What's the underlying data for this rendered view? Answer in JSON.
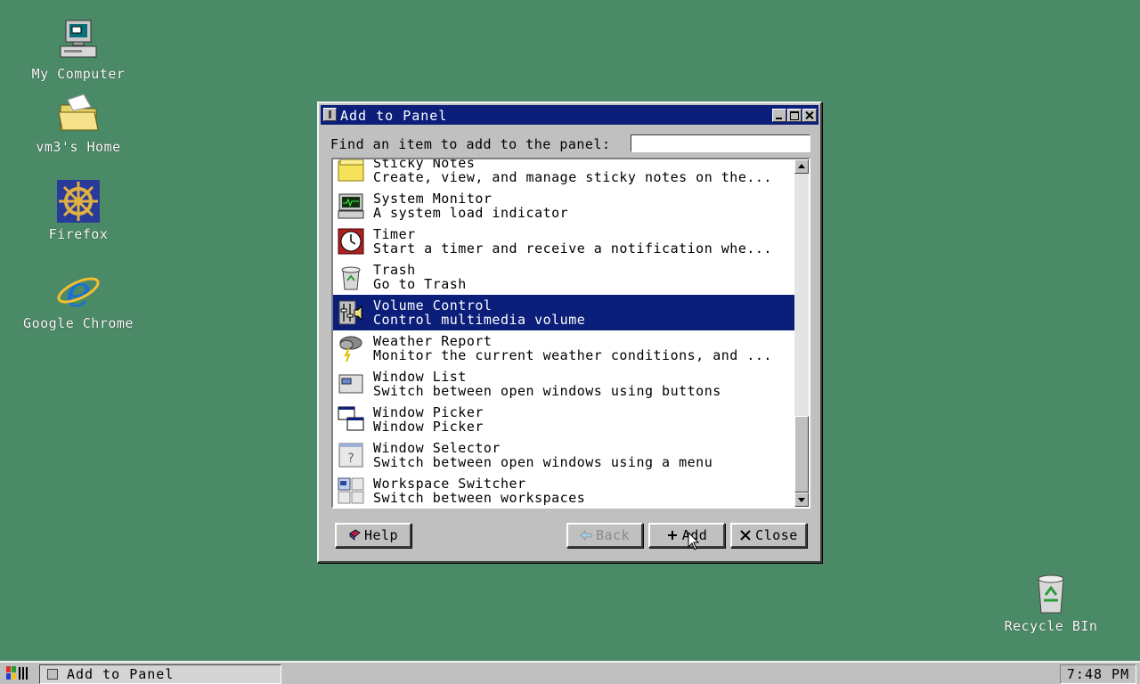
{
  "desktop": {
    "icons": [
      {
        "label": "My Computer",
        "icon": "computer-icon"
      },
      {
        "label": "vm3's Home",
        "icon": "folder-icon"
      },
      {
        "label": "Firefox",
        "icon": "firefox-icon"
      },
      {
        "label": "Google Chrome",
        "icon": "chrome-icon"
      },
      {
        "label": "Recycle BIn",
        "icon": "recycle-bin-icon"
      }
    ]
  },
  "window": {
    "title": "Add to Panel",
    "find_label": "Find an item to add to the panel:",
    "find_value": "",
    "items": [
      {
        "name": "Sticky Notes",
        "desc": "Create, view, and manage sticky notes on the...",
        "icon": "sticky-notes-icon"
      },
      {
        "name": "System Monitor",
        "desc": "A system load indicator",
        "icon": "system-monitor-icon"
      },
      {
        "name": "Timer",
        "desc": "Start a timer and receive a notification whe...",
        "icon": "timer-icon"
      },
      {
        "name": "Trash",
        "desc": "Go to Trash",
        "icon": "trash-icon"
      },
      {
        "name": "Volume Control",
        "desc": "Control multimedia volume",
        "icon": "volume-control-icon",
        "selected": true
      },
      {
        "name": "Weather Report",
        "desc": "Monitor the current weather conditions, and ...",
        "icon": "weather-icon"
      },
      {
        "name": "Window List",
        "desc": "Switch between open windows using buttons",
        "icon": "window-list-icon"
      },
      {
        "name": "Window Picker",
        "desc": "Window Picker",
        "icon": "window-picker-icon"
      },
      {
        "name": "Window Selector",
        "desc": "Switch between open windows using a menu",
        "icon": "window-selector-icon"
      },
      {
        "name": "Workspace Switcher",
        "desc": "Switch between workspaces",
        "icon": "workspace-switcher-icon"
      }
    ],
    "buttons": {
      "help": "Help",
      "back": "Back",
      "add": "Add",
      "close": "Close"
    }
  },
  "taskbar": {
    "task_title": "Add to Panel",
    "clock": "7:48 PM"
  },
  "colors": {
    "desktop_bg": "#4b8a67",
    "titlebar": "#0a1e7a",
    "selection": "#0a1e7a",
    "face": "#c0c0c0"
  }
}
